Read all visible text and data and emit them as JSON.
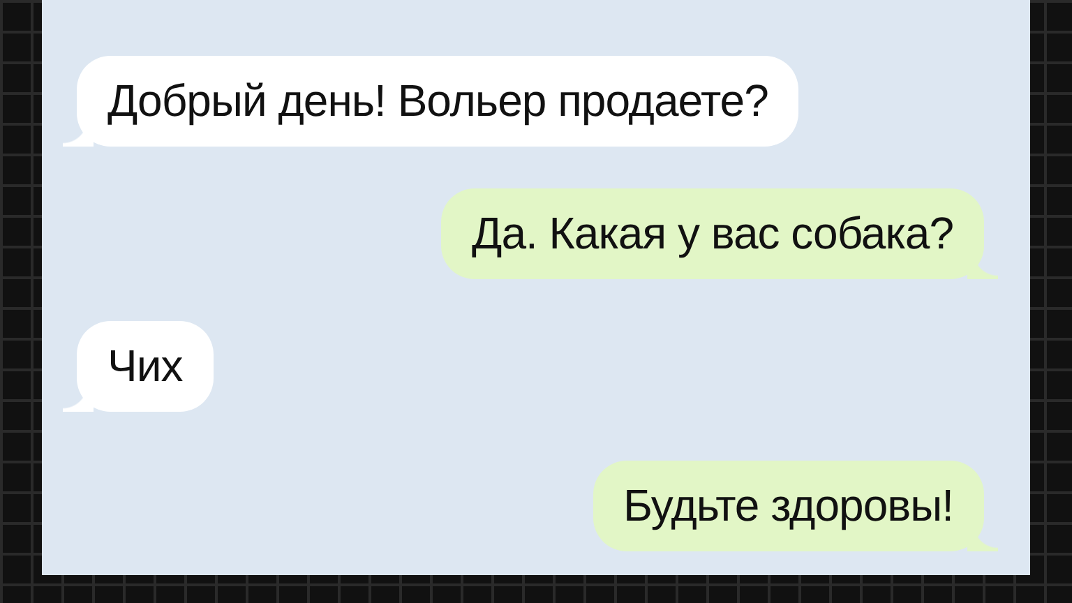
{
  "messages": [
    {
      "text": "Добрый день! Вольер продаете?",
      "outgoing": false
    },
    {
      "text": "Да. Какая у вас собака?",
      "outgoing": true
    },
    {
      "text": "Чих",
      "outgoing": false
    },
    {
      "text": "Будьте здоровы!",
      "outgoing": true
    }
  ]
}
